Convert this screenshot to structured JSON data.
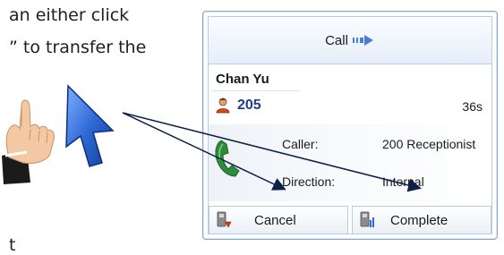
{
  "background_text": {
    "line1": "an either click",
    "line2": "” to transfer the",
    "line3": "t"
  },
  "call_panel": {
    "header_label": "Call",
    "caller_name": "Chan Yu",
    "extension": "205",
    "duration": "36s",
    "details": {
      "caller_label": "Caller:",
      "caller_value": "200  Receptionist",
      "direction_label": "Direction:",
      "direction_value": "Internal"
    },
    "buttons": {
      "cancel_label": "Cancel",
      "complete_label": "Complete"
    }
  },
  "icons": {
    "header_arrow": "right-arrow-icon",
    "person": "person-icon",
    "phone": "phone-handset-icon",
    "cancel": "cancel-transfer-icon",
    "complete": "complete-transfer-icon",
    "hand": "pointing-hand-icon",
    "cursor": "mouse-cursor-icon"
  },
  "colors": {
    "extension_text": "#1c3c8c",
    "panel_border": "#8aa6c4",
    "header_gradient_bottom": "#e6eef8",
    "arrow_blue": "#4a7cd8",
    "phone_green": "#2e8b3a"
  }
}
